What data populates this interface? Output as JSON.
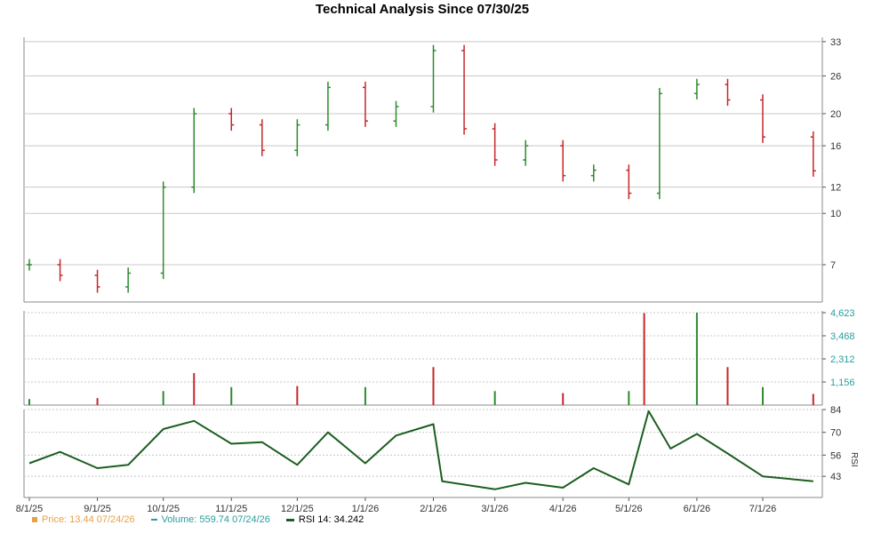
{
  "title": "Technical Analysis Since 07/30/25",
  "colors": {
    "up": "#2e8b2e",
    "down": "#c62828",
    "volume_label": "#2a9d9d",
    "price_label": "#e8a04a",
    "rsi_line": "#1b5e20",
    "grid": "#c8c8c8",
    "axis": "#555555"
  },
  "legend": {
    "price": "Price: 13.44  07/24/26",
    "volume": "Volume: 559.74  07/24/26",
    "rsi": "RSI 14: 34.242"
  },
  "rsi_axis_label": "RSI",
  "x_ticks": [
    "8/1/25",
    "9/1/25",
    "10/1/25",
    "11/1/25",
    "12/1/25",
    "1/1/26",
    "2/1/26",
    "3/1/26",
    "4/1/26",
    "5/1/26",
    "6/1/26",
    "7/1/26"
  ],
  "chart_data": {
    "type": "stock-ohlc-volume-rsi",
    "price_axis": {
      "scale": "log",
      "ticks": [
        7,
        10,
        12,
        16,
        20,
        26,
        33
      ]
    },
    "volume_axis": {
      "ticks": [
        "1,156",
        "2,312",
        "3,468",
        "4,623"
      ],
      "max": 4623
    },
    "rsi_axis": {
      "ticks": [
        43,
        56,
        70,
        84
      ],
      "range": [
        30,
        84
      ]
    },
    "price_series": {
      "dates": [
        "8/1/25",
        "8/15/25",
        "9/1/25",
        "9/15/25",
        "10/1/25",
        "10/15/25",
        "11/1/25",
        "11/15/25",
        "12/1/25",
        "12/15/25",
        "1/1/26",
        "1/15/26",
        "2/1/26",
        "2/15/26",
        "3/1/26",
        "3/15/26",
        "4/1/26",
        "4/15/26",
        "5/1/26",
        "5/15/26",
        "6/1/26",
        "6/15/26",
        "7/1/26",
        "7/24/26"
      ],
      "close": [
        7.0,
        6.5,
        6.0,
        6.6,
        12.0,
        20.0,
        18.5,
        15.5,
        18.5,
        24.0,
        19.0,
        21.0,
        31.0,
        18.0,
        14.5,
        16.0,
        13.0,
        13.5,
        11.5,
        23.0,
        24.5,
        22.0,
        17.0,
        13.44
      ]
    },
    "volume_series": {
      "dates": [
        "8/1/25",
        "9/1/25",
        "10/1/25",
        "10/15/25",
        "11/1/25",
        "12/1/25",
        "1/1/26",
        "2/1/26",
        "3/1/26",
        "4/1/26",
        "5/1/26",
        "5/8/26",
        "6/1/26",
        "6/15/26",
        "7/1/26",
        "7/24/26"
      ],
      "values": [
        300,
        350,
        700,
        1600,
        900,
        950,
        900,
        1900,
        700,
        600,
        700,
        4600,
        4623,
        1900,
        900,
        559.74
      ]
    },
    "rsi_series": {
      "dates": [
        "8/1/25",
        "8/15/25",
        "9/1/25",
        "9/15/25",
        "10/1/25",
        "10/15/25",
        "11/1/25",
        "11/15/25",
        "12/1/25",
        "12/15/25",
        "1/1/26",
        "1/15/26",
        "2/1/26",
        "2/5/26",
        "3/1/26",
        "3/15/26",
        "4/1/26",
        "4/15/26",
        "5/1/26",
        "5/10/26",
        "5/20/26",
        "6/1/26",
        "6/15/26",
        "7/1/26",
        "7/24/26"
      ],
      "values": [
        51,
        58,
        48,
        50,
        72,
        77,
        63,
        64,
        50,
        70,
        51,
        68,
        75,
        40,
        35,
        39,
        36,
        48,
        38,
        83,
        60,
        69,
        57,
        43,
        40
      ]
    }
  }
}
